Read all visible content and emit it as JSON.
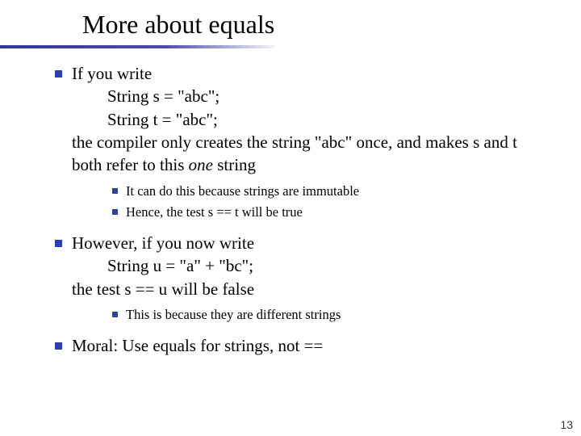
{
  "title": {
    "prefix": "More about ",
    "code": "equals"
  },
  "b1": {
    "line1a": "If you write",
    "code1": "String s = \"abc\";",
    "code2": "String t = \"abc\";",
    "line2a": "the compiler only creates the string ",
    "line2b": "\"abc\"",
    "line2c": " once, and makes ",
    "line2d": "s",
    "line2e": " and ",
    "line2f": "t",
    "line3a": "both refer to this ",
    "line3b": "one",
    "line3c": " string"
  },
  "b1s1": "It can do this because strings are immutable",
  "b1s2": {
    "a": "Hence, the test ",
    "b": "s == t",
    "c": " will be ",
    "d": "true"
  },
  "b2": {
    "line1": "However, if you now write",
    "code": "String u = \"a\" + \"bc\";",
    "line2a": "the test ",
    "line2b": "s == u",
    "line2c": " will be ",
    "line2d": "false"
  },
  "b2s1": "This is because they are different strings",
  "b3": {
    "a": "Moral: Use ",
    "b": "equals",
    "c": " for strings, not ",
    "d": "=="
  },
  "page_number": "13"
}
